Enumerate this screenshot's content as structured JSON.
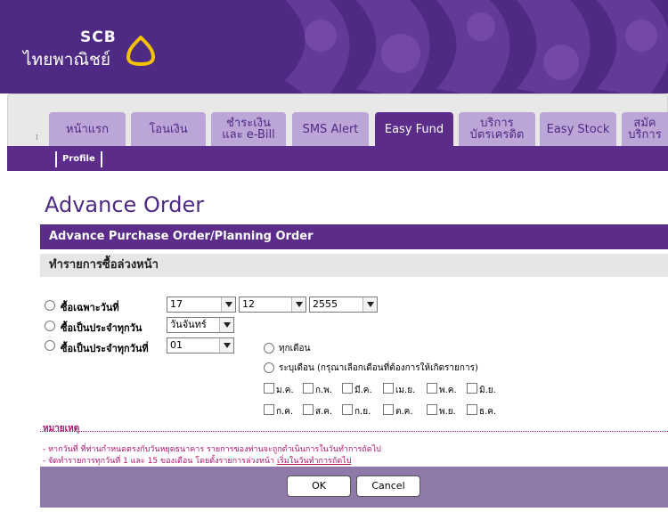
{
  "brand": {
    "en": "SCB",
    "th": "ไทยพาณิชย์",
    "logo_icon": "scb-bell-icon",
    "colors": {
      "primary": "#5b2c8a",
      "tab": "#bca6d8",
      "note": "#b0146e",
      "footer": "#8e79a8"
    }
  },
  "nav": {
    "tabs": [
      {
        "label": "หน้าแรก"
      },
      {
        "label": "โอนเงิน"
      },
      {
        "label": "ชำระเงิน\nและ e-Bill"
      },
      {
        "label": "SMS Alert"
      },
      {
        "label": "Easy Fund",
        "active": true
      },
      {
        "label": "บริการ\nบัตรเครดิต"
      },
      {
        "label": "Easy Stock"
      },
      {
        "label": "สมัค\nบริการ"
      }
    ],
    "sub": {
      "profile": "Profile"
    }
  },
  "page": {
    "title": "Advance Order",
    "panel_title": "Advance Purchase Order/Planning Order",
    "panel_subtitle": "ทำรายการซื้อล่วงหน้า"
  },
  "form": {
    "option1": {
      "label": "ซื้อเฉพาะวันที่",
      "day": "17",
      "month": "12",
      "year": "2555"
    },
    "option2": {
      "label": "ซื้อเป็นประจำทุกวัน",
      "weekday": "วันจันทร์"
    },
    "option3": {
      "label": "ซื้อเป็นประจำทุกวันที่",
      "day": "01"
    },
    "every_month": "ทุกเดือน",
    "specify_month": "ระบุเดือน (กรุณาเลือกเดือนที่ต้องการให้เกิดรายการ)",
    "months_row1": [
      "ม.ค.",
      "ก.พ.",
      "มี.ค.",
      "เม.ย.",
      "พ.ค.",
      "มิ.ย."
    ],
    "months_row2": [
      "ก.ค.",
      "ส.ค.",
      "ก.ย.",
      "ต.ค.",
      "พ.ย.",
      "ธ.ค."
    ]
  },
  "notes": {
    "title": "หมายเหตุ",
    "line1": "- หากวันที่ ที่ท่านกำหนดตรงกับวันหยุดธนาคาร รายการของท่านจะถูกดำเนินการในวันทำการถัดไป",
    "line2_a": "- จัดทำรายการทุกวันที่ 1 และ 15 ของเดือน โดยตั้งรายการล่วงหน้า ",
    "line2_b": "เริ่มในวันทำการถัดไป"
  },
  "buttons": {
    "ok": "OK",
    "cancel": "Cancel"
  }
}
